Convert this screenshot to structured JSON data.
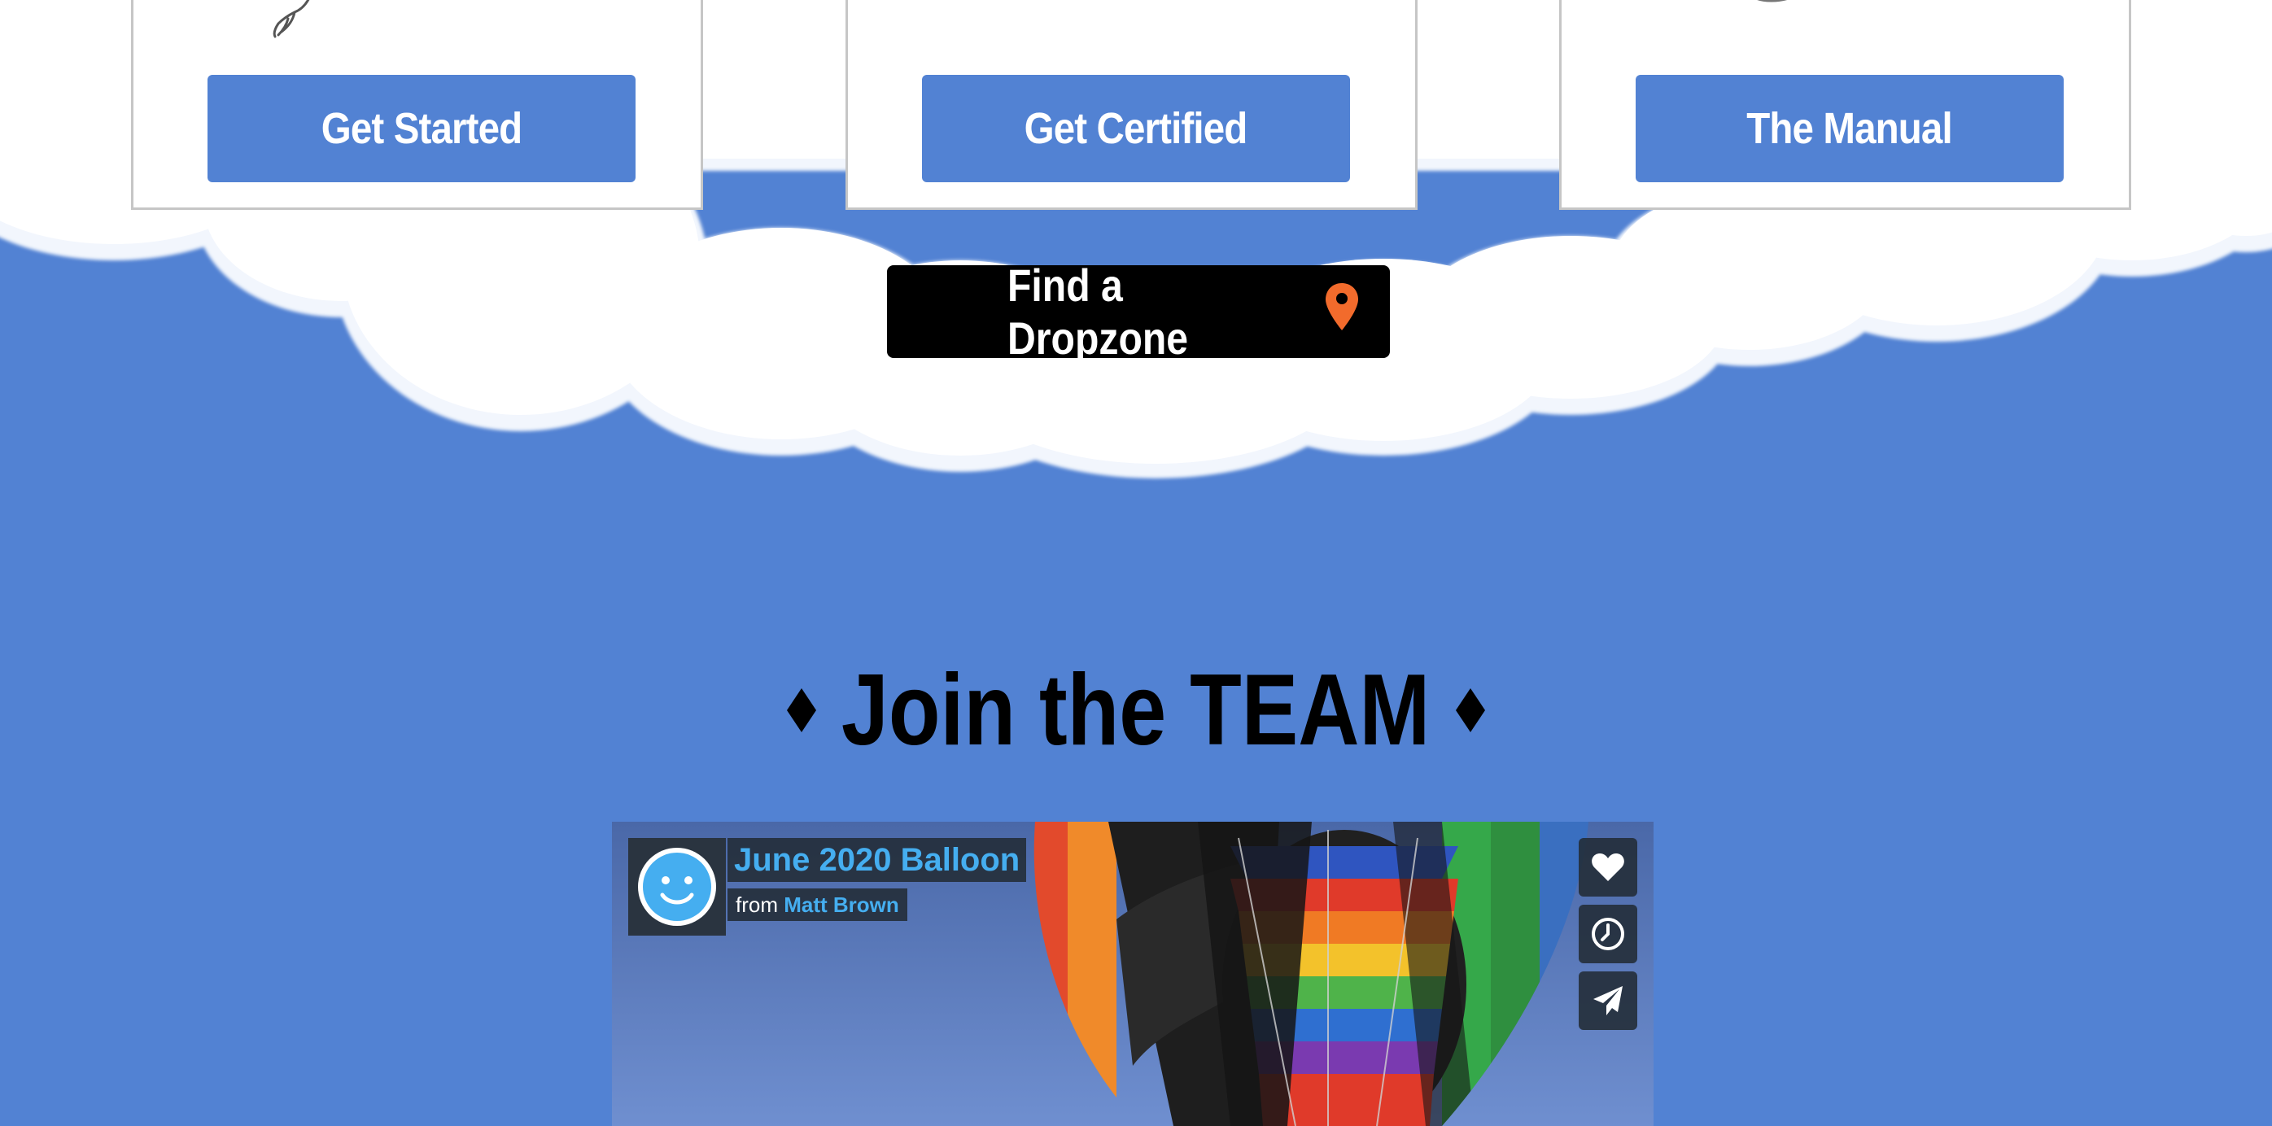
{
  "colors": {
    "background": "#5282d3",
    "card_button": "#5282d3",
    "find_button": "#000000",
    "pin": "#f26b2c",
    "video_link": "#45aef0"
  },
  "cards": [
    {
      "button_label": "Get Started",
      "icon": "skydiver-hand-illustration"
    },
    {
      "button_label": "Get Certified",
      "icon": "certificate-illustration"
    },
    {
      "button_label": "The Manual",
      "icon": "manual-illustration"
    }
  ],
  "find_dropzone": {
    "label": "Find a Dropzone",
    "icon": "map-pin-icon"
  },
  "section": {
    "title": "Join the TEAM",
    "decoration_icon": "diamond-icon"
  },
  "video": {
    "title": "June 2020 Balloon",
    "from_prefix": "from",
    "author": "Matt Brown",
    "avatar_icon": "smiley-avatar-icon",
    "actions": [
      "heart-icon",
      "clock-icon",
      "paper-plane-icon"
    ]
  }
}
